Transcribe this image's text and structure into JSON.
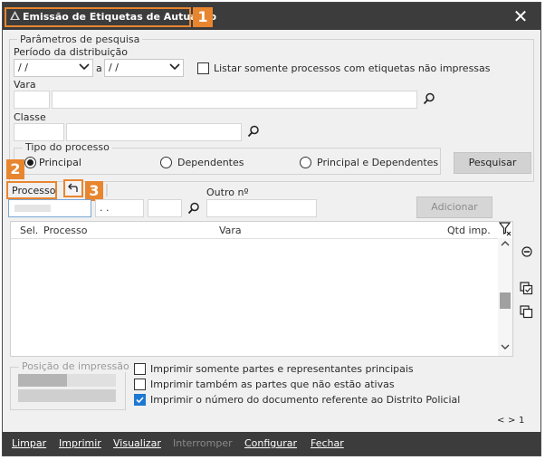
{
  "window": {
    "title": "Emissão de Etiquetas de Autuação",
    "close_glyph": "✕"
  },
  "badges": [
    "1",
    "2",
    "3"
  ],
  "search_params": {
    "legend": "Parâmetros de pesquisa",
    "period_label": "Período da distribuição",
    "date_from": "/ /",
    "date_sep": "a",
    "date_to": "/ /",
    "only_unprinted_label": "Listar somente processos com etiquetas não impressas",
    "only_unprinted_checked": false,
    "vara_label": "Vara",
    "classe_label": "Classe"
  },
  "process_type": {
    "legend": "Tipo do processo",
    "options": [
      "Principal",
      "Dependentes",
      "Principal e Dependentes"
    ],
    "selected": "Principal"
  },
  "search_button": "Pesquisar",
  "processo": {
    "label": "Processo",
    "undo_icon": "undo-arrow-icon",
    "number_mask": ". .",
    "outro_label": "Outro nº",
    "add_button": "Adicionar"
  },
  "grid": {
    "columns": [
      "Sel.",
      "Processo",
      "Vara",
      "Qtd imp."
    ],
    "rows": []
  },
  "print_position": {
    "legend": "Posição de impressão"
  },
  "print_options": [
    {
      "label": "Imprimir somente partes e representantes principais",
      "checked": false
    },
    {
      "label": "Imprimir também as partes que não estão ativas",
      "checked": false
    },
    {
      "label": "Imprimir o número do documento referente ao Distrito Policial",
      "checked": true
    }
  ],
  "pager": {
    "prev": "<",
    "next": ">",
    "page": "1"
  },
  "footer": {
    "items": [
      {
        "label": "Limpar",
        "enabled": true
      },
      {
        "label": "Imprimir",
        "enabled": true
      },
      {
        "label": "Visualizar",
        "enabled": true
      },
      {
        "label": "Interromper",
        "enabled": false
      },
      {
        "label": "Configurar",
        "enabled": true
      },
      {
        "label": "Fechar",
        "enabled": true
      }
    ]
  },
  "colors": {
    "titlebar": "#3c3c3c",
    "accent_badge": "#e8862f",
    "check_on": "#1e78d2"
  }
}
